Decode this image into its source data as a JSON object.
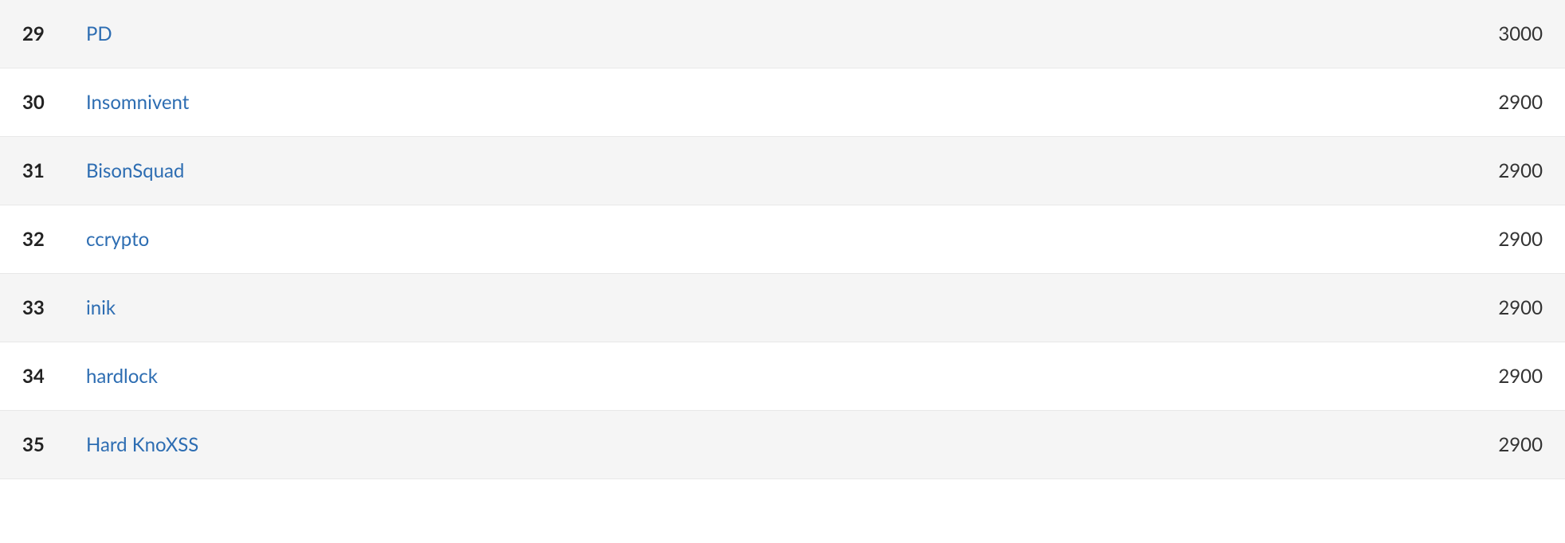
{
  "leaderboard": {
    "rows": [
      {
        "rank": "29",
        "name": "PD",
        "score": "3000"
      },
      {
        "rank": "30",
        "name": "Insomnivent",
        "score": "2900"
      },
      {
        "rank": "31",
        "name": "BisonSquad",
        "score": "2900"
      },
      {
        "rank": "32",
        "name": "ccrypto",
        "score": "2900"
      },
      {
        "rank": "33",
        "name": "inik",
        "score": "2900"
      },
      {
        "rank": "34",
        "name": "hardlock",
        "score": "2900"
      },
      {
        "rank": "35",
        "name": "Hard KnoXSS",
        "score": "2900"
      }
    ]
  }
}
